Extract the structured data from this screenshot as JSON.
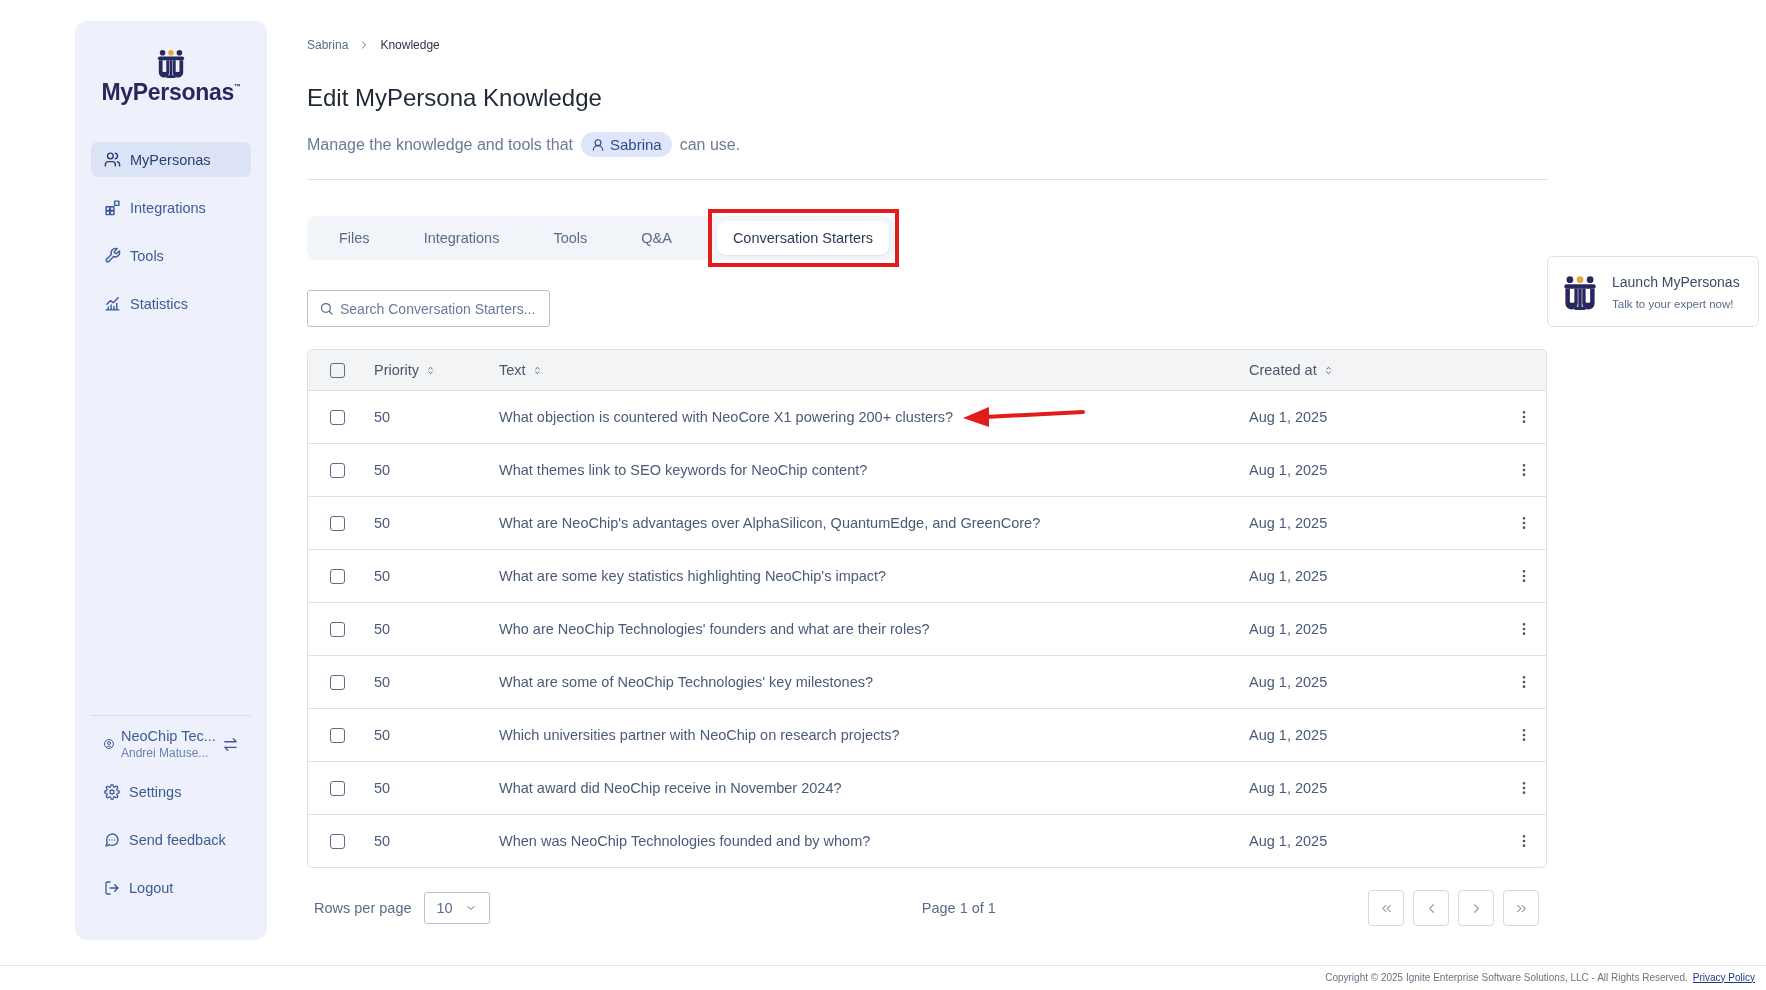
{
  "sidebar": {
    "logo": {
      "wordmark": "MyPersonas",
      "trademark": "™"
    },
    "nav": [
      {
        "label": "MyPersonas",
        "selected": true
      },
      {
        "label": "Integrations",
        "selected": false
      },
      {
        "label": "Tools",
        "selected": false
      },
      {
        "label": "Statistics",
        "selected": false
      }
    ],
    "account": {
      "organization": "NeoChip Tec...",
      "user": "Andrei Matuse..."
    },
    "bottom": [
      {
        "label": "Settings"
      },
      {
        "label": "Send feedback"
      },
      {
        "label": "Logout"
      }
    ]
  },
  "breadcrumb": [
    "Sabrina",
    "Knowledge"
  ],
  "title": "Edit MyPersona Knowledge",
  "subtitle": {
    "before": "Manage the knowledge and tools that",
    "persona": "Sabrina",
    "after": "can use."
  },
  "tabs": [
    {
      "label": "Files",
      "selected": false,
      "highlighted": false
    },
    {
      "label": "Integrations",
      "selected": false,
      "highlighted": false
    },
    {
      "label": "Tools",
      "selected": false,
      "highlighted": false
    },
    {
      "label": "Q&A",
      "selected": false,
      "highlighted": false
    },
    {
      "label": "Conversation Starters",
      "selected": true,
      "highlighted": true
    }
  ],
  "search": {
    "placeholder": "Search Conversation Starters..."
  },
  "table": {
    "select_all_checked": false,
    "columns": [
      "Priority",
      "Text",
      "Created at"
    ],
    "rows": [
      {
        "checked": false,
        "priority": "50",
        "text": "What objection is countered with NeoCore X1 powering 200+ clusters?",
        "created": "Aug 1, 2025",
        "pointed": true
      },
      {
        "checked": false,
        "priority": "50",
        "text": "What themes link to SEO keywords for NeoChip content?",
        "created": "Aug 1, 2025",
        "pointed": false
      },
      {
        "checked": false,
        "priority": "50",
        "text": "What are NeoChip's advantages over AlphaSilicon, QuantumEdge, and GreenCore?",
        "created": "Aug 1, 2025",
        "pointed": false
      },
      {
        "checked": false,
        "priority": "50",
        "text": "What are some key statistics highlighting NeoChip's impact?",
        "created": "Aug 1, 2025",
        "pointed": false
      },
      {
        "checked": false,
        "priority": "50",
        "text": "Who are NeoChip Technologies' founders and what are their roles?",
        "created": "Aug 1, 2025",
        "pointed": false
      },
      {
        "checked": false,
        "priority": "50",
        "text": "What are some of NeoChip Technologies' key milestones?",
        "created": "Aug 1, 2025",
        "pointed": false
      },
      {
        "checked": false,
        "priority": "50",
        "text": "Which universities partner with NeoChip on research projects?",
        "created": "Aug 1, 2025",
        "pointed": false
      },
      {
        "checked": false,
        "priority": "50",
        "text": "What award did NeoChip receive in November 2024?",
        "created": "Aug 1, 2025",
        "pointed": false
      },
      {
        "checked": false,
        "priority": "50",
        "text": "When was NeoChip Technologies founded and by whom?",
        "created": "Aug 1, 2025",
        "pointed": false
      }
    ]
  },
  "pagination": {
    "rows_per_page_label": "Rows per page",
    "rows_per_page": "10",
    "page": "Page 1 of 1"
  },
  "launch": {
    "title": "Launch MyPersonas",
    "subtitle": "Talk to your expert now!"
  },
  "footer": {
    "copyright": "Copyright © 2025 Ignite Enterprise Software Solutions, LLC - All Rights Reserved.",
    "link": "Privacy Policy"
  }
}
